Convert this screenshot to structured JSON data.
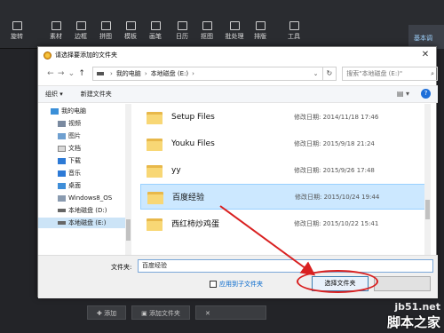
{
  "toolbar": {
    "items": [
      "旋转",
      "素材",
      "边框",
      "拼图",
      "模板",
      "画笔",
      "日历",
      "抠图",
      "批处理",
      "排版",
      "工具"
    ],
    "right_tab": "基本调"
  },
  "bottom_bar": {
    "add": "添加",
    "add_folder": "添加文件夹"
  },
  "dialog": {
    "title": "请选择要添加的文件夹",
    "address": {
      "computer": "我的电脑",
      "drive": "本地磁盘 (E:)"
    },
    "search_placeholder": "搜索\"本地磁盘 (E:)\"",
    "commands": {
      "organize": "组织 ▾",
      "new_folder": "新建文件夹"
    },
    "nav_items": [
      {
        "label": "我的电脑",
        "icon": "computer-icon"
      },
      {
        "label": "视频",
        "icon": "video-folder-icon"
      },
      {
        "label": "图片",
        "icon": "pictures-folder-icon"
      },
      {
        "label": "文档",
        "icon": "documents-folder-icon"
      },
      {
        "label": "下载",
        "icon": "download-folder-icon"
      },
      {
        "label": "音乐",
        "icon": "music-folder-icon"
      },
      {
        "label": "桌面",
        "icon": "desktop-folder-icon"
      },
      {
        "label": "Windows8_OS",
        "icon": "drive-icon"
      },
      {
        "label": "本地磁盘 (D:)",
        "icon": "drive-icon"
      },
      {
        "label": "本地磁盘 (E:)",
        "icon": "drive-icon"
      }
    ],
    "files": [
      {
        "name": "Setup Files",
        "modified": "修改日期: 2014/11/18 17:46"
      },
      {
        "name": "Youku Files",
        "modified": "修改日期: 2015/9/18 21:24"
      },
      {
        "name": "yy",
        "modified": "修改日期: 2015/9/26 17:48"
      },
      {
        "name": "百度经验",
        "modified": "修改日期: 2015/10/24 19:44"
      },
      {
        "name": "西红柿炒鸡蛋",
        "modified": "修改日期: 2015/10/22 15:41"
      }
    ],
    "folder_label": "文件夹:",
    "folder_value": "百度经验",
    "subfolder_label": "应用到子文件夹",
    "select_button": "选择文件夹"
  },
  "watermark": {
    "line1": "jb51.net",
    "line2": "脚本之家"
  }
}
